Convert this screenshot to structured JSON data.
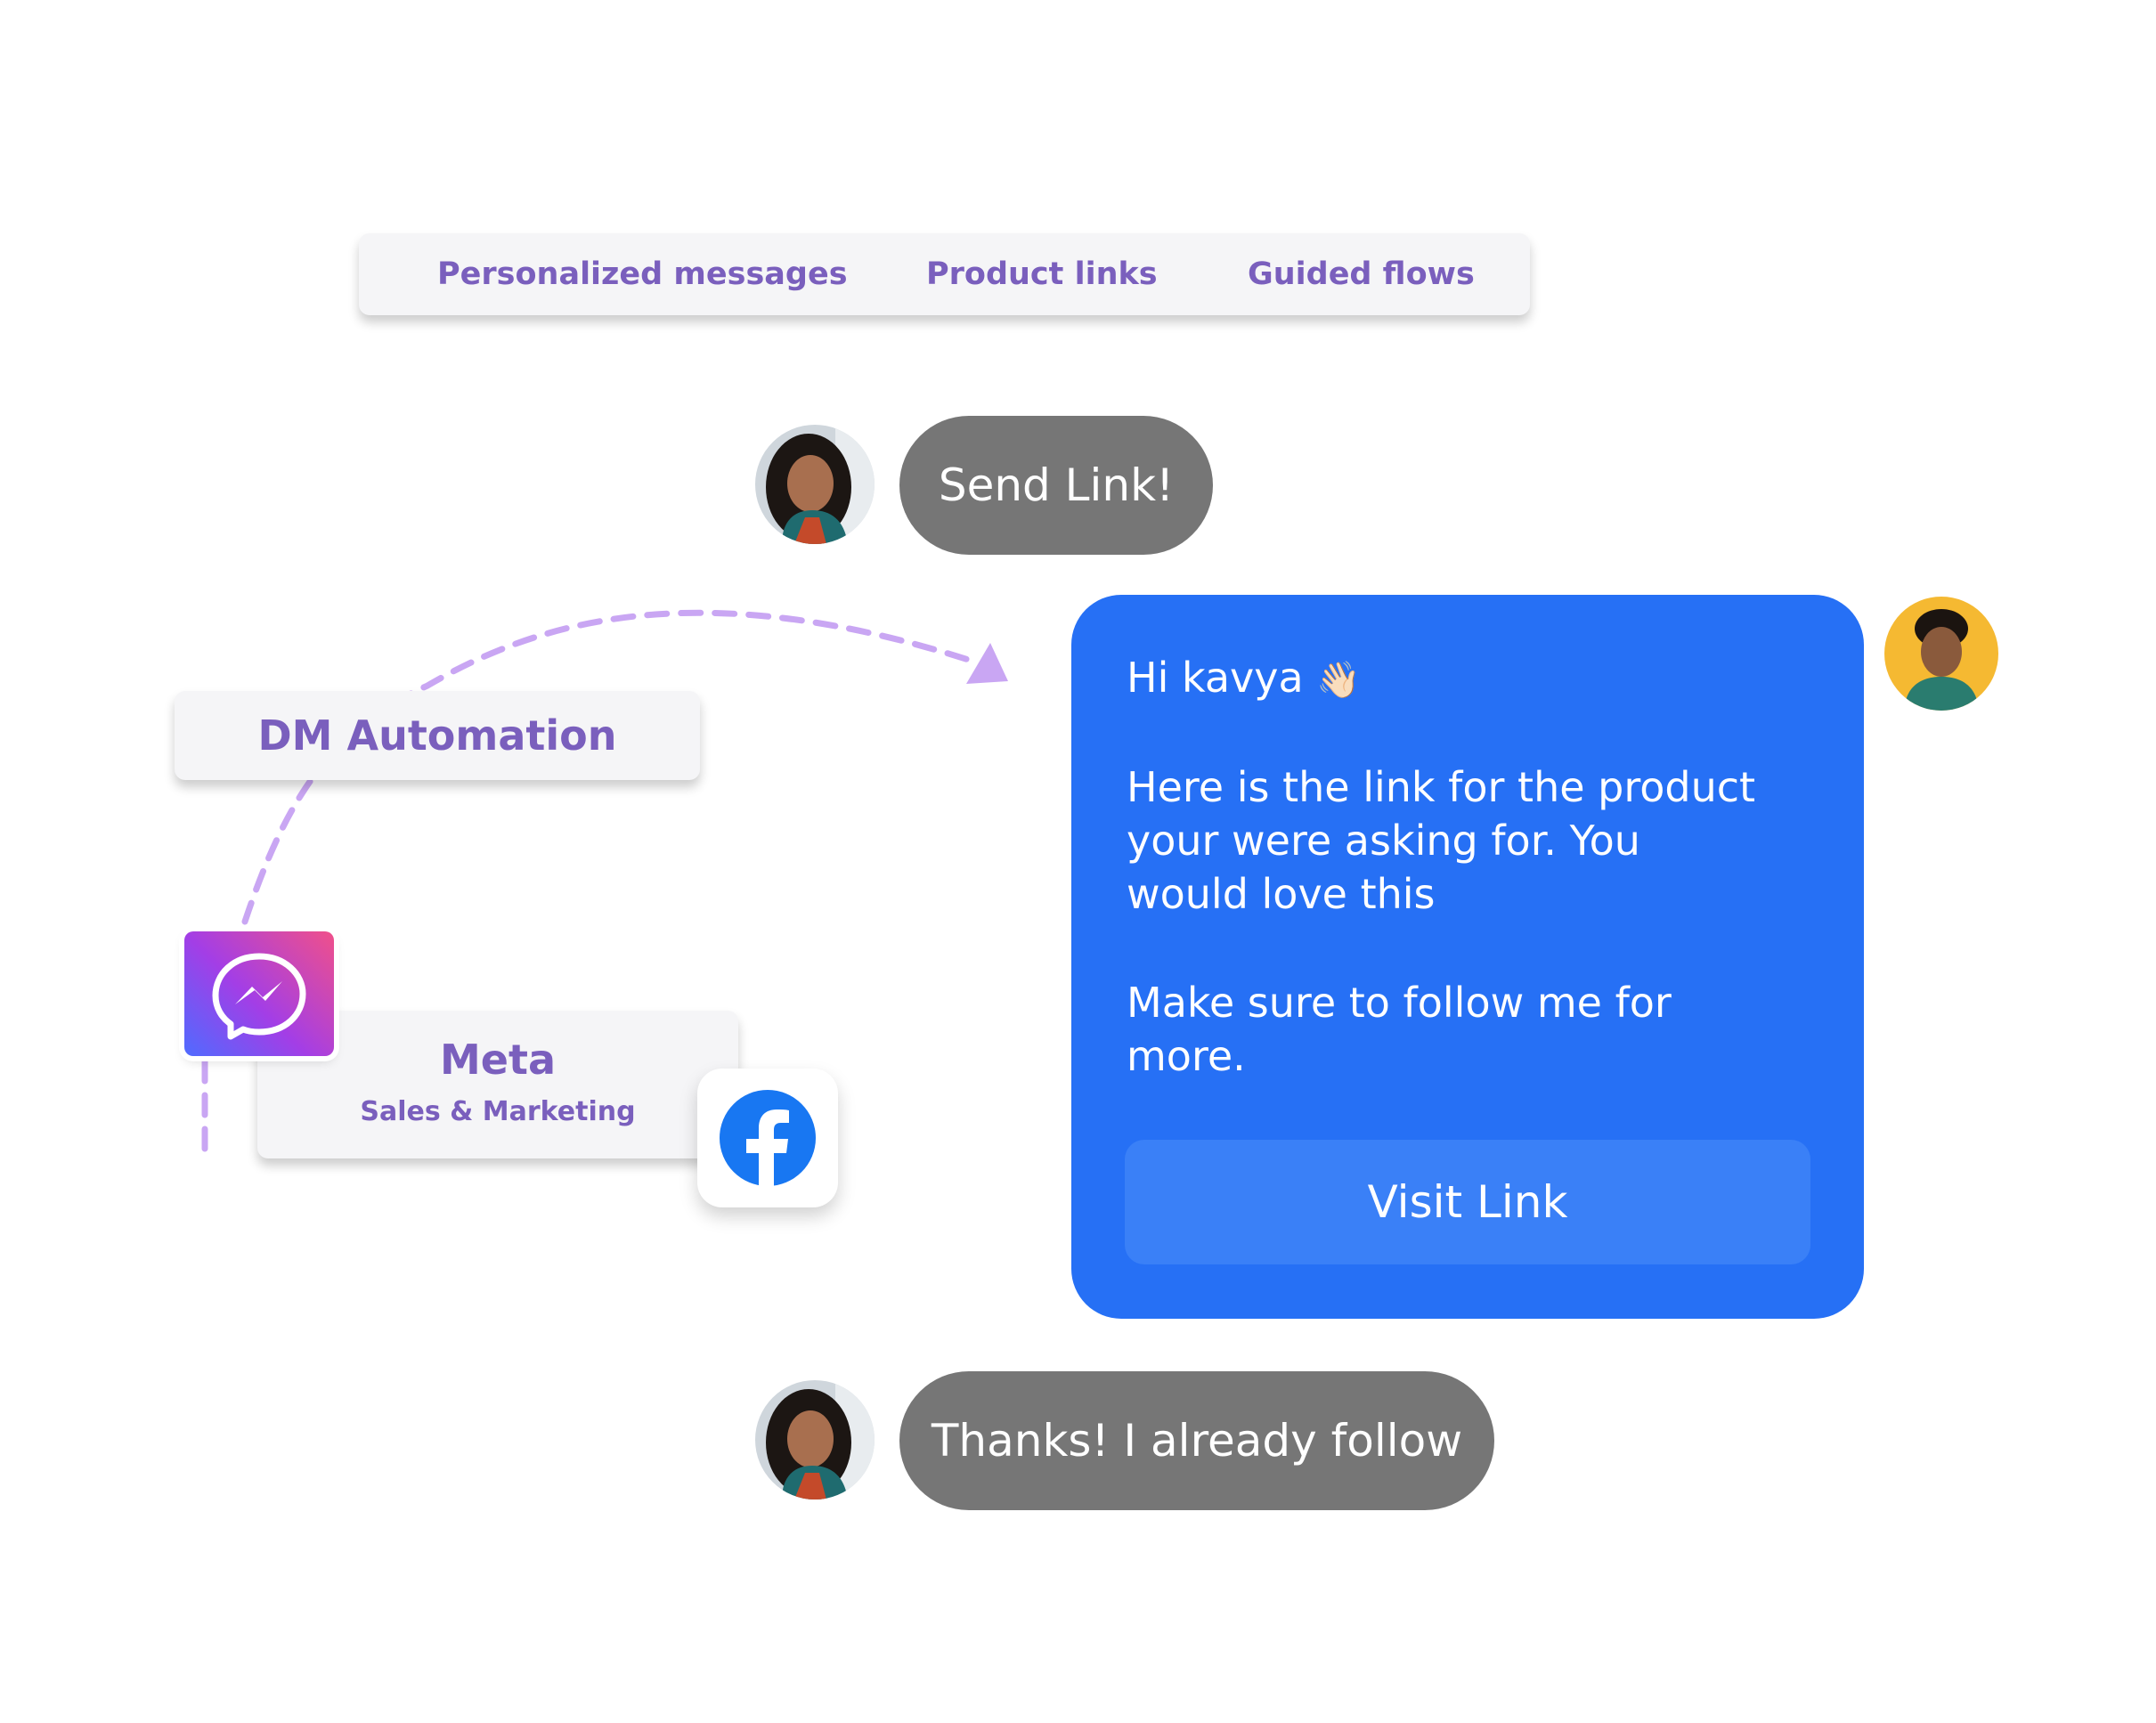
{
  "features": {
    "tabs": [
      {
        "label": "Personalized messages"
      },
      {
        "label": "Product links"
      },
      {
        "label": "Guided flows"
      }
    ]
  },
  "automation": {
    "label": "DM Automation"
  },
  "integration": {
    "title": "Meta",
    "subtitle": "Sales & Marketing",
    "icons": [
      "messenger-icon",
      "facebook-icon"
    ]
  },
  "chat": {
    "customer_message_1": "Send Link!",
    "reply": {
      "greeting": "Hi kavya",
      "greeting_emoji": "👋🏻",
      "body_lines": [
        "Here is the link for the product",
        "your were asking for. You",
        "would love this"
      ],
      "closing_lines": [
        "Make sure to follow me for",
        "more."
      ],
      "button_label": "Visit Link"
    },
    "customer_message_2": "Thanks! I already follow"
  },
  "colors": {
    "accent_purple": "#7a5fbd",
    "reply_blue": "#2670f5",
    "button_blue": "#3a80f7",
    "bubble_gray": "#767676",
    "dashed_line": "#c9a6f3",
    "facebook_blue": "#1877f2"
  }
}
